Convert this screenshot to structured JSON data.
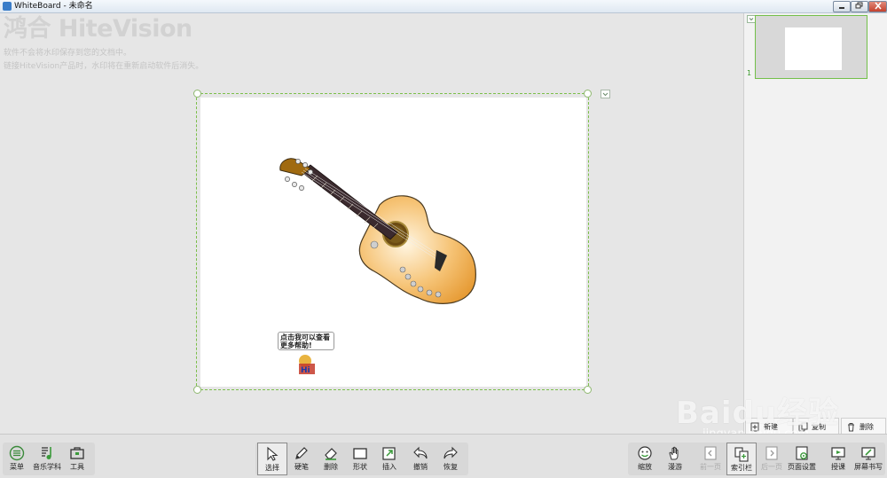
{
  "window": {
    "title": "WhiteBoard - 未命名"
  },
  "watermark": {
    "logo_cn": "鸿合",
    "logo_en": "HiteVision",
    "line1": "软件不会将水印保存到您的文档中。",
    "line2": "链接HiteVision产品时，水印将在重新启动软件后消失。"
  },
  "canvas": {
    "help_bubble_line1": "点击我可以查看",
    "help_bubble_line2": "更多帮助!",
    "help_logo_text": "Hi"
  },
  "side_panel": {
    "thumbnail_number": "1",
    "new_label": "新建",
    "copy_label": "复制",
    "delete_label": "删除"
  },
  "toolbar": {
    "left": [
      "菜单",
      "音乐学科",
      "工具"
    ],
    "center": [
      "选择",
      "硬笔",
      "删除",
      "形状",
      "插入",
      "撤销",
      "恢复"
    ],
    "right": [
      "缩放",
      "漫游",
      "前一页",
      "索引栏",
      "后一页",
      "页面设置",
      "授课",
      "屏幕书写"
    ]
  },
  "colors": {
    "accent": "#7cbf4a",
    "guitar_body": "#f4b25a",
    "thumbnail_border": "#73c04a"
  },
  "icons": [
    "menu-icon",
    "music-icon",
    "toolbox-icon",
    "cursor-icon",
    "pen-icon",
    "eraser-icon",
    "rectangle-icon",
    "insert-icon",
    "undo-icon",
    "redo-icon",
    "zoom-icon",
    "hand-icon",
    "prev-page-icon",
    "index-icon",
    "next-page-icon",
    "page-settings-icon",
    "lecture-icon",
    "screen-write-icon"
  ],
  "overlay": {
    "baidu_logo": "Baidu经验",
    "baidu_url": "jingyan.baidu.com"
  }
}
